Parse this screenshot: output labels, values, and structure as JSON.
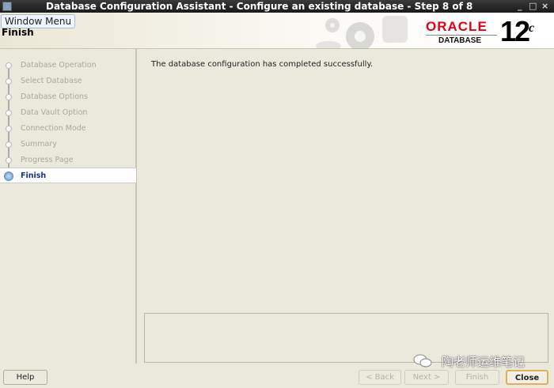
{
  "window": {
    "title": "Database Configuration Assistant - Configure an existing database - Step 8 of 8",
    "tooltip": "Window Menu",
    "controls": [
      "_",
      "□",
      "×"
    ]
  },
  "header": {
    "page_title": "Finish",
    "brand": "ORACLE",
    "brand_sub": "DATABASE",
    "version": "12",
    "version_suffix": "c"
  },
  "steps": [
    {
      "label": "Database Operation",
      "active": false
    },
    {
      "label": "Select Database",
      "active": false
    },
    {
      "label": "Database Options",
      "active": false
    },
    {
      "label": "Data Vault Option",
      "active": false
    },
    {
      "label": "Connection Mode",
      "active": false
    },
    {
      "label": "Summary",
      "active": false
    },
    {
      "label": "Progress Page",
      "active": false
    },
    {
      "label": "Finish",
      "active": true
    }
  ],
  "main": {
    "message": "The database configuration has completed successfully."
  },
  "buttons": {
    "help": "Help",
    "back": "< Back",
    "next": "Next >",
    "finish": "Finish",
    "close": "Close"
  },
  "watermark": "陶老师运维笔记"
}
